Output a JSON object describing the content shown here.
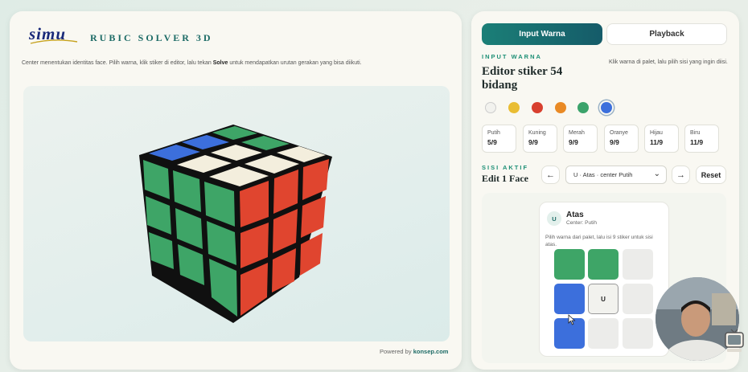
{
  "brand": {
    "logo": "simu",
    "title": "RUBIC SOLVER 3D"
  },
  "description": {
    "before": "Center menentukan identitas face. Pilih warna, klik stiker di editor, lalu tekan ",
    "bold": "Solve",
    "after": " untuk mendapatkan urutan gerakan yang bisa diikuti."
  },
  "footer": {
    "prefix": "Powered by ",
    "brand": "konsep.com"
  },
  "tabs": [
    {
      "label": "Input Warna",
      "active": true
    },
    {
      "label": "Playback",
      "active": false
    }
  ],
  "input_section": {
    "label": "INPUT WARNA",
    "title_line1": "Editor stiker 54",
    "title_line2": "bidang",
    "hint": "Klik warna di palet, lalu pilih sisi yang ingin diisi."
  },
  "palette": [
    {
      "name": "white",
      "color": "#f2f2ee",
      "selected": false
    },
    {
      "name": "yellow",
      "color": "#e9bd33",
      "selected": false
    },
    {
      "name": "red",
      "color": "#d8402f",
      "selected": false
    },
    {
      "name": "orange",
      "color": "#e98a25",
      "selected": false
    },
    {
      "name": "green",
      "color": "#3ba36b",
      "selected": false
    },
    {
      "name": "blue",
      "color": "#3c6fdc",
      "selected": true
    }
  ],
  "counts": [
    {
      "name": "Putih",
      "value": "5/9"
    },
    {
      "name": "Kuning",
      "value": "9/9"
    },
    {
      "name": "Merah",
      "value": "9/9"
    },
    {
      "name": "Oranye",
      "value": "9/9"
    },
    {
      "name": "Hijau",
      "value": "11/9"
    },
    {
      "name": "Biru",
      "value": "11/9"
    }
  ],
  "active_side": {
    "label": "SISI AKTIF",
    "title": "Edit 1 Face",
    "prev": "←",
    "next": "→",
    "select_value": "U · Atas · center Putih",
    "reset": "Reset"
  },
  "face": {
    "badge": "U",
    "name": "Atas",
    "center_text": "Center: Putih",
    "instruction": "Pilih warna dari palet, lalu isi 9 stiker untuk sisi atas.",
    "center_label": "U",
    "grid": [
      "#3ea567",
      "#3ea567",
      "#ececea",
      "#3c6fdc",
      "#f2f2ee",
      "#ececea",
      "#3c6fdc",
      "#ececea",
      "#ececea"
    ]
  },
  "colors": {
    "accent": "#1b7f77",
    "navy": "#1a2a7a"
  }
}
